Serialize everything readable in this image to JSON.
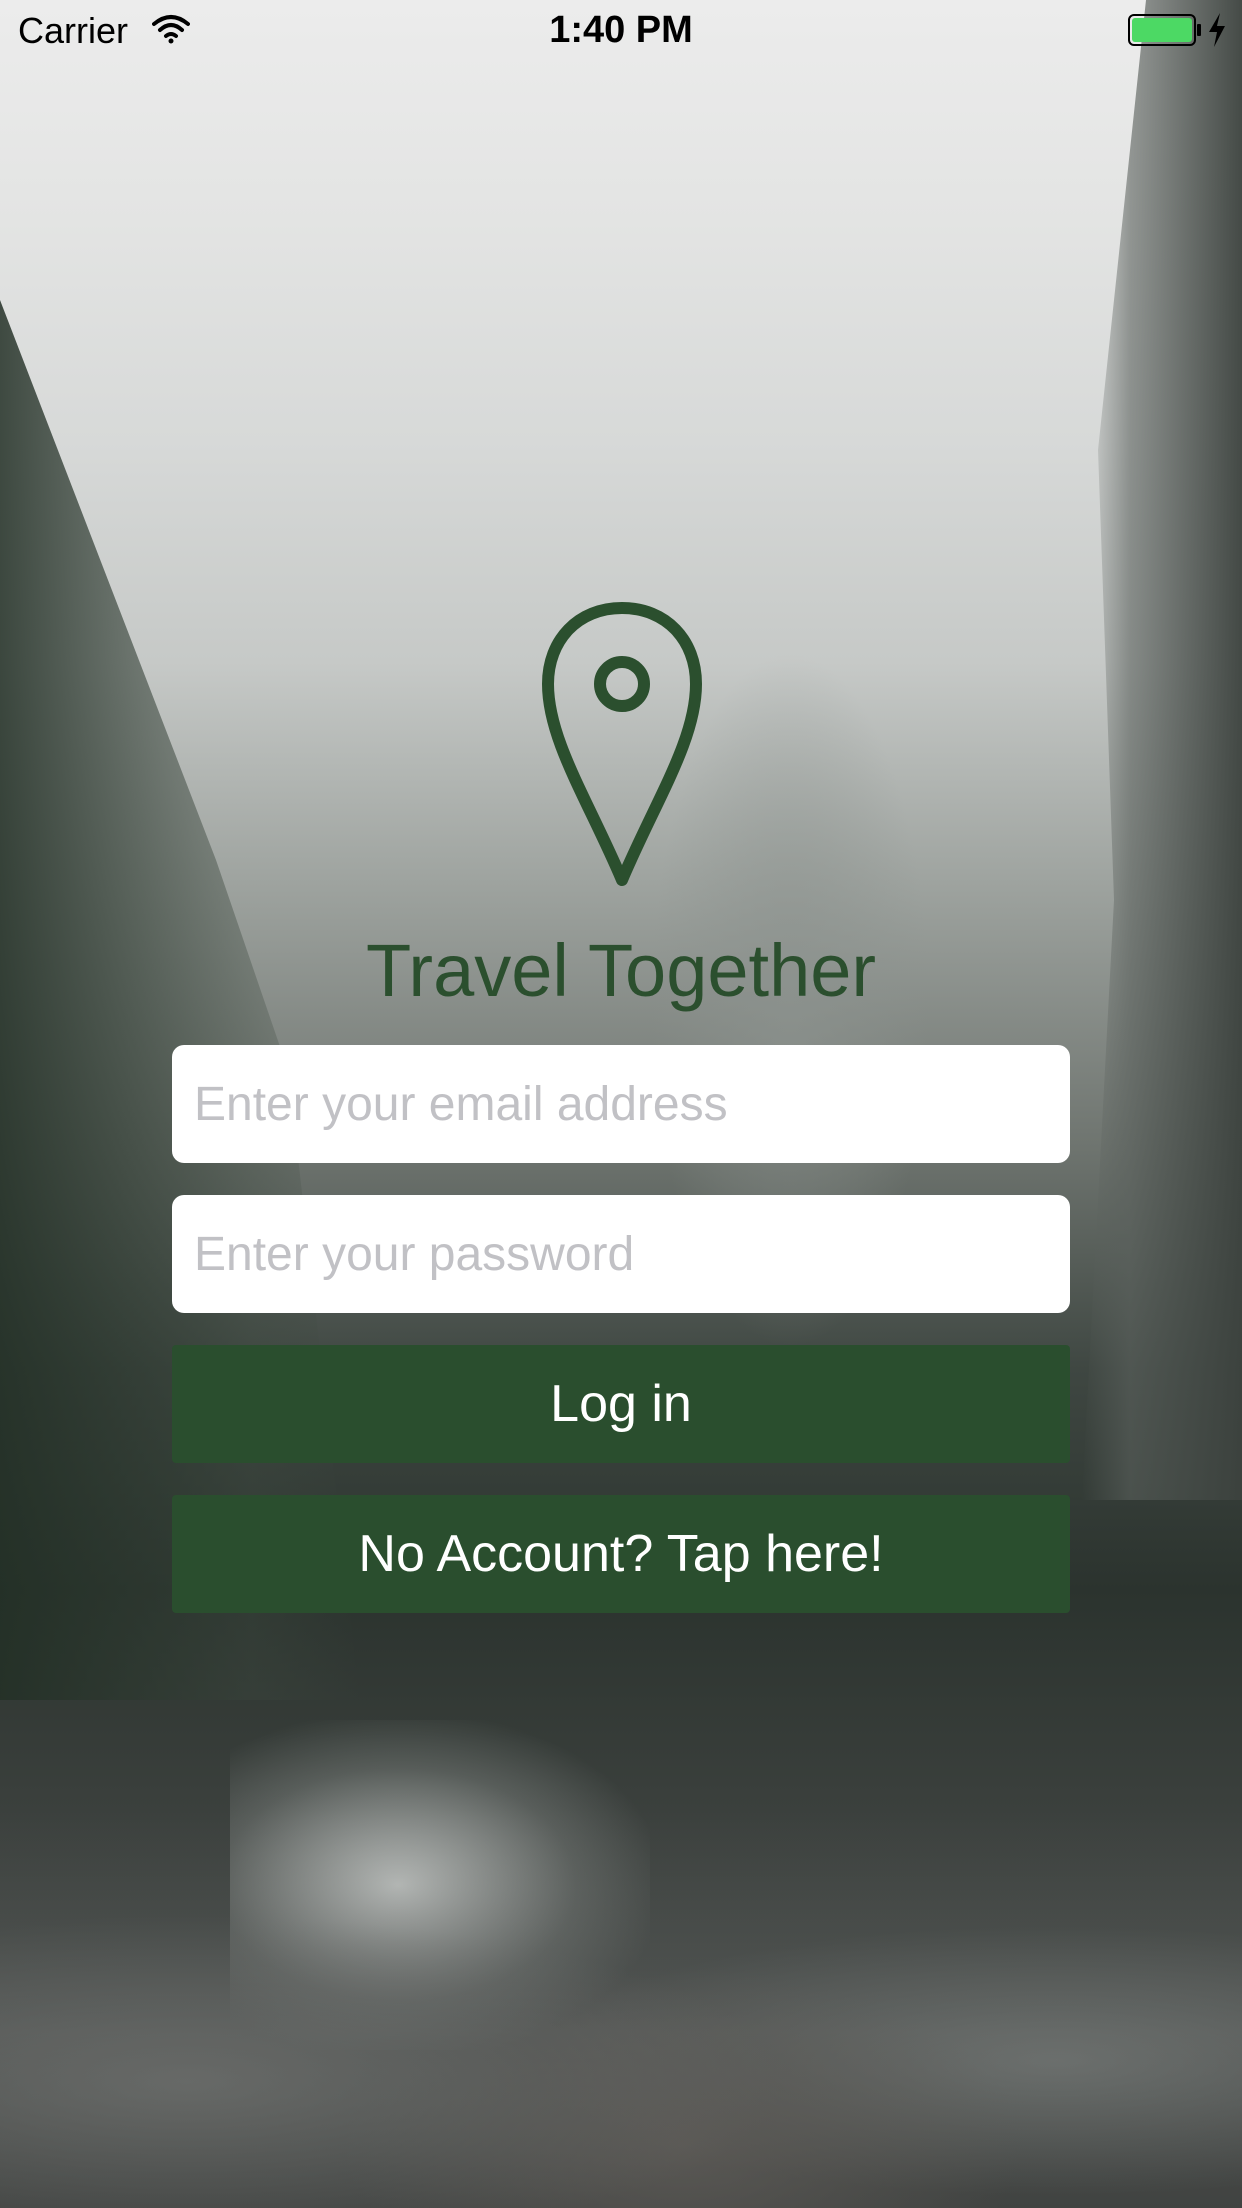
{
  "status_bar": {
    "carrier": "Carrier",
    "time": "1:40 PM",
    "wifi_icon": "wifi-icon",
    "battery_icon": "battery-icon",
    "charging_icon": "charging-bolt-icon",
    "battery_color": "#4cd964"
  },
  "app": {
    "logo_icon": "map-pin-icon",
    "title": "Travel Together",
    "brand_color": "#2a4e2e"
  },
  "login_form": {
    "email_placeholder": "Enter your email address",
    "email_value": "",
    "password_placeholder": "Enter your password",
    "password_value": "",
    "login_label": "Log in",
    "signup_label": "No Account? Tap here!"
  }
}
